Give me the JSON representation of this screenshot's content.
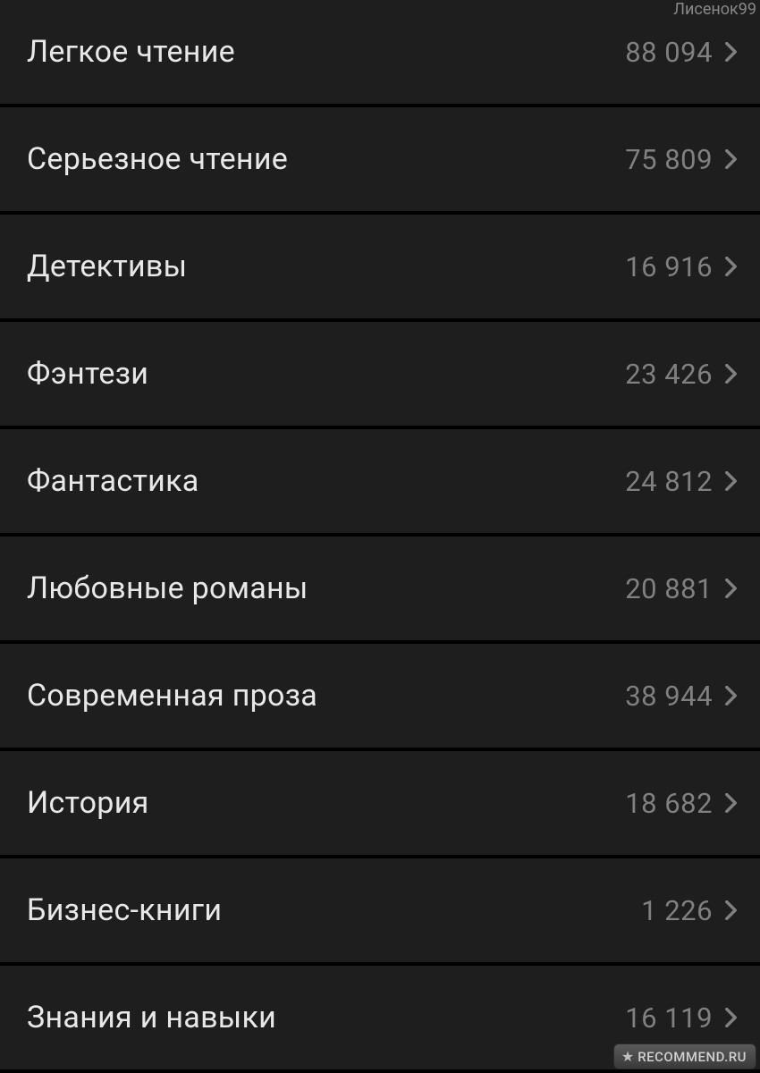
{
  "watermarks": {
    "top": "Лисенок99",
    "bottom": "RECOMMEND.RU"
  },
  "categories": [
    {
      "label": "Легкое чтение",
      "count": "88 094"
    },
    {
      "label": "Серьезное чтение",
      "count": "75 809"
    },
    {
      "label": "Детективы",
      "count": "16 916"
    },
    {
      "label": "Фэнтези",
      "count": "23 426"
    },
    {
      "label": "Фантастика",
      "count": "24 812"
    },
    {
      "label": "Любовные романы",
      "count": "20 881"
    },
    {
      "label": "Современная проза",
      "count": "38 944"
    },
    {
      "label": "История",
      "count": "18 682"
    },
    {
      "label": "Бизнес-книги",
      "count": "1 226"
    },
    {
      "label": "Знания и навыки",
      "count": "16 119"
    }
  ]
}
